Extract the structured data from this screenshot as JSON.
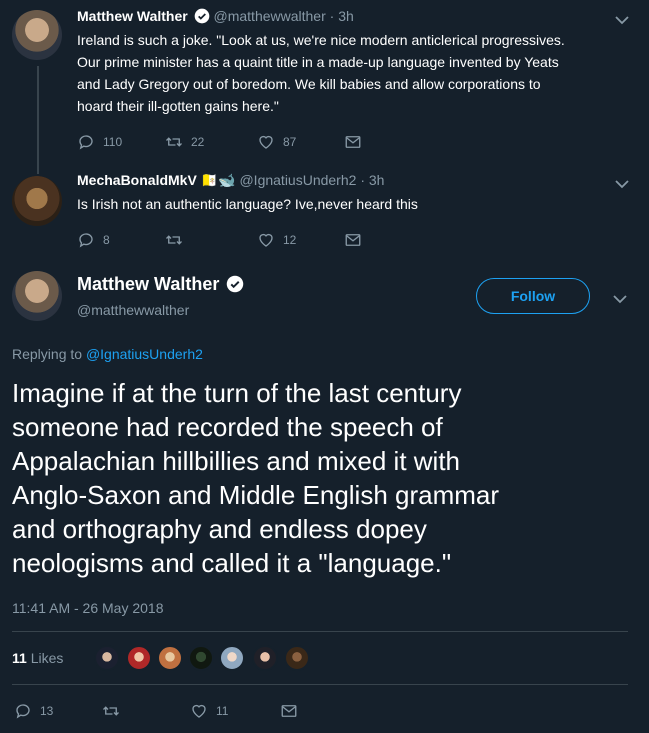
{
  "tweet1": {
    "name": "Matthew Walther",
    "handle": "@matthewwalther",
    "time": "· 3h",
    "text_lines": [
      "Ireland is such a joke. \"Look at us, we're nice modern anticlerical progressives.",
      "Our prime minister has a quaint title in a made-up language invented by Yeats",
      "and Lady Gregory out of boredom. We kill babies and allow corporations to",
      "hoard their ill-gotten gains here.\""
    ],
    "replies": "110",
    "retweets": "22",
    "likes": "87"
  },
  "tweet2": {
    "name": "MechaBonaldMkV",
    "emoji": "🇻🇦🐋",
    "handle": "@IgnatiusUnderh2",
    "time": "· 3h",
    "text": "Is Irish not an authentic language? Ive,never heard this",
    "replies": "8",
    "retweets": "",
    "likes": "12"
  },
  "main": {
    "name": "Matthew Walther",
    "handle": "@matthewwalther",
    "follow_label": "Follow",
    "replying_prefix": "Replying to",
    "replying_handle": "@IgnatiusUnderh2",
    "text_lines": [
      "Imagine if at the turn of the last century",
      "someone had recorded the speech of",
      "Appalachian hillbillies and mixed it with",
      "Anglo-Saxon and Middle English grammar",
      "and orthography and endless dopey",
      "neologisms and called it a \"language.\""
    ],
    "timestamp": "11:41 AM - 26 May 2018",
    "likes_count": "11",
    "likes_label": "Likes",
    "replies": "13",
    "retweets": "",
    "likes": "11"
  },
  "colors": {
    "background": "#15202b",
    "accent": "#1da1f2",
    "muted": "#8899a6",
    "divider": "#38444d"
  }
}
